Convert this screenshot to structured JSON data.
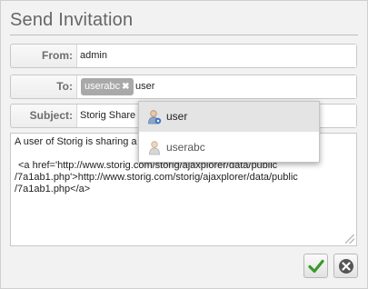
{
  "dialog": {
    "title": "Send Invitation"
  },
  "from": {
    "label": "From:",
    "value": "admin"
  },
  "to": {
    "label": "To:",
    "chips": [
      {
        "label": "userabc"
      }
    ],
    "input_value": "user"
  },
  "subject": {
    "label": "Subject:",
    "value": "Storig Share"
  },
  "message": {
    "line1": "A user of Storig is sharing a",
    "line2": "<a href='http://www.storig.com/storig/ajaxplorer/data/public",
    "line3": "/7a1ab1.php'>http://www.storig.com/storig/ajaxplorer/data/public",
    "line4": "/7a1ab1.php</a>"
  },
  "suggestions": [
    {
      "label": "user",
      "icon": "user-shared-icon",
      "selected": true
    },
    {
      "label": "userabc",
      "icon": "user-icon",
      "selected": false
    }
  ],
  "buttons": {
    "confirm_icon": "check-icon",
    "cancel_icon": "close-icon"
  },
  "colors": {
    "confirm": "#3a9a2a",
    "cancel": "#555555"
  }
}
